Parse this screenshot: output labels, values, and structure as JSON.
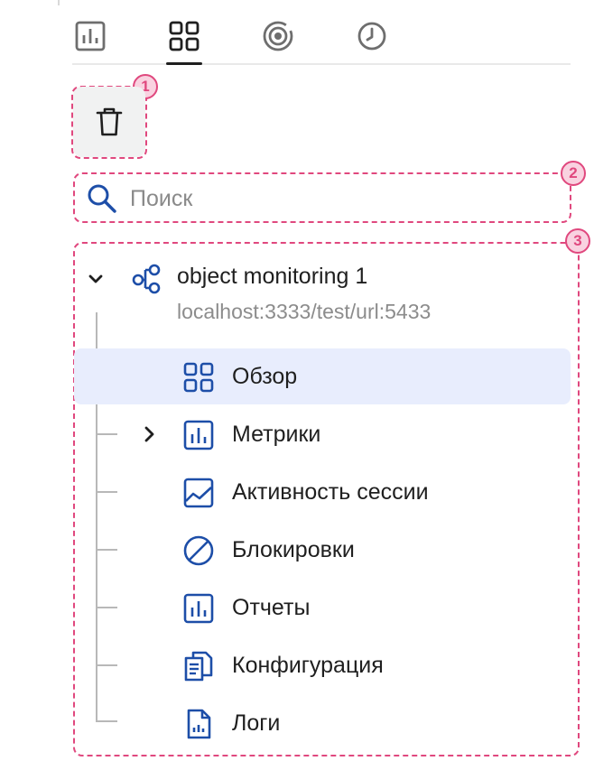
{
  "tabs": [
    {
      "name": "chart-icon",
      "active": false
    },
    {
      "name": "grid-icon",
      "active": true
    },
    {
      "name": "target-icon",
      "active": false
    },
    {
      "name": "clock-icon",
      "active": false
    }
  ],
  "markers": [
    "1",
    "2",
    "3"
  ],
  "search": {
    "placeholder": "Поиск",
    "value": ""
  },
  "tree": {
    "root": {
      "title": "object monitoring 1",
      "url": "localhost:3333/test/url:5433",
      "expanded": true,
      "icon": "nodes-icon"
    },
    "items": [
      {
        "label": "Обзор",
        "icon": "grid-icon",
        "selected": true,
        "expandable": false
      },
      {
        "label": "Метрики",
        "icon": "chart-icon",
        "selected": false,
        "expandable": true
      },
      {
        "label": "Активность сессии",
        "icon": "area-chart-icon",
        "selected": false,
        "expandable": false
      },
      {
        "label": "Блокировки",
        "icon": "blocked-icon",
        "selected": false,
        "expandable": false
      },
      {
        "label": "Отчеты",
        "icon": "chart-icon",
        "selected": false,
        "expandable": false
      },
      {
        "label": "Конфигурация",
        "icon": "documents-icon",
        "selected": false,
        "expandable": false
      },
      {
        "label": "Логи",
        "icon": "log-file-icon",
        "selected": false,
        "expandable": false
      }
    ]
  },
  "colors": {
    "accent": "#1d4ea8",
    "highlight": "#e0487e",
    "selected_bg": "#e8edfd"
  }
}
